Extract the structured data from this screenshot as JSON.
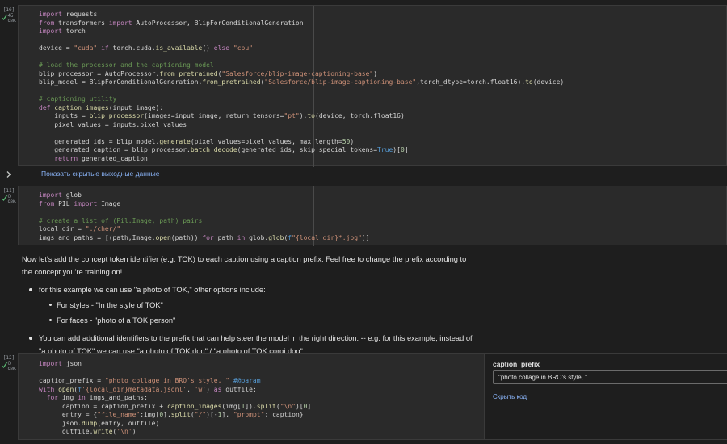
{
  "cells": [
    {
      "exec_count": "[10]",
      "exec_time": [
        "45",
        "сек."
      ],
      "code_lines": [
        "import requests",
        "from transformers import AutoProcessor, BlipForConditionalGeneration",
        "import torch",
        "",
        "device = \"cuda\" if torch.cuda.is_available() else \"cpu\"",
        "",
        "# load the processor and the captioning model",
        "blip_processor = AutoProcessor.from_pretrained(\"Salesforce/blip-image-captioning-base\")",
        "blip_model = BlipForConditionalGeneration.from_pretrained(\"Salesforce/blip-image-captioning-base\",torch_dtype=torch.float16).to(device)",
        "",
        "# captioning utility",
        "def caption_images(input_image):",
        "    inputs = blip_processor(images=input_image, return_tensors=\"pt\").to(device, torch.float16)",
        "    pixel_values = inputs.pixel_values",
        "",
        "    generated_ids = blip_model.generate(pixel_values=pixel_values, max_length=50)",
        "    generated_caption = blip_processor.batch_decode(generated_ids, skip_special_tokens=True)[0]",
        "    return generated_caption"
      ],
      "output_toggle_label": "Показать скрытые выходные данные"
    },
    {
      "exec_count": "[11]",
      "exec_time": [
        "0",
        "сек."
      ],
      "code_lines": [
        "import glob",
        "from PIL import Image",
        "",
        "# create a list of (Pil.Image, path) pairs",
        "local_dir = \"./cher/\"",
        "imgs_and_paths = [(path,Image.open(path)) for path in glob.glob(f\"{local_dir}*.jpg\")]"
      ]
    },
    {
      "exec_count": "[12]",
      "exec_time": [
        "0",
        "сек."
      ],
      "code_lines": [
        "import json",
        "",
        "caption_prefix = \"photo collage in BRO's style, \" #@param",
        "with open(f'{local_dir}metadata.jsonl', 'w') as outfile:",
        "  for img in imgs_and_paths:",
        "      caption = caption_prefix + caption_images(img[1]).split(\"\\n\")[0]",
        "      entry = {\"file_name\":img[0].split(\"/\")[-1], \"prompt\": caption}",
        "      json.dump(entry, outfile)",
        "      outfile.write('\\n')"
      ],
      "form": {
        "param_label": "caption_prefix",
        "param_value": "\"photo collage in BRO's style, \"",
        "hide_code_label": "Скрыть код"
      }
    }
  ],
  "markdown": {
    "paragraph": "Now let's add the concept token identifier (e.g. TOK) to each caption using a caption prefix. Feel free to change the prefix according to the concept you're training on!",
    "bullet1": "for this example we can use \"a photo of TOK,\" other options include:",
    "sub1": "For styles - \"In the style of TOK\"",
    "sub2": "For faces - \"photo of a TOK person\"",
    "bullet2": "You can add additional identifiers to the prefix that can help steer the model in the right direction. -- e.g. for this example, instead of \"a photo of TOK\" we can use \"a photo of TOK dog\" / \"a photo of TOK corgi dog\""
  },
  "colors": {
    "background": "#1e1e1e",
    "cell_background": "#2a2a2a",
    "keyword": "#c586c0",
    "string": "#ce9178",
    "comment": "#6a9955",
    "link": "#8ab4f8",
    "success_check": "#5bb974"
  },
  "icons": {
    "status": "check-icon",
    "toggle": "chevron-right-icon"
  }
}
